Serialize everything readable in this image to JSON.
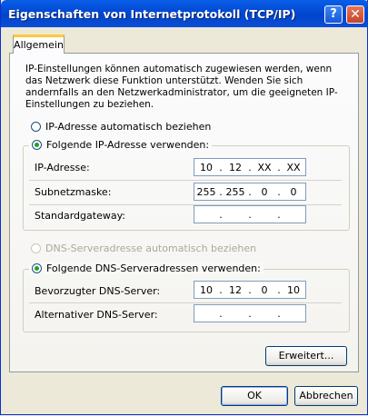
{
  "window": {
    "title": "Eigenschaften von Internetprotokoll (TCP/IP)",
    "help_glyph": "?",
    "close_glyph": "✕"
  },
  "tab": {
    "label": "Allgemein"
  },
  "description": "IP-Einstellungen können automatisch zugewiesen werden, wenn das Netzwerk diese Funktion unterstützt. Wenden Sie sich andernfalls an den Netzwerkadministrator, um die geeigneten IP-Einstellungen zu beziehen.",
  "ip": {
    "auto_label": "IP-Adresse automatisch beziehen",
    "manual_label": "Folgende IP-Adresse verwenden:",
    "address_label": "IP-Adresse:",
    "address": [
      "10",
      "12",
      "XX",
      "XX"
    ],
    "subnet_label": "Subnetzmaske:",
    "subnet": [
      "255",
      "255",
      "0",
      "0"
    ],
    "gateway_label": "Standardgateway:",
    "gateway": [
      "",
      "",
      "",
      ""
    ]
  },
  "dns": {
    "auto_label": "DNS-Serveradresse automatisch beziehen",
    "manual_label": "Folgende DNS-Serveradressen verwenden:",
    "preferred_label": "Bevorzugter DNS-Server:",
    "preferred": [
      "10",
      "12",
      "0",
      "10"
    ],
    "alternate_label": "Alternativer DNS-Server:",
    "alternate": [
      "",
      "",
      "",
      ""
    ]
  },
  "buttons": {
    "advanced": "Erweitert...",
    "ok": "OK",
    "cancel": "Abbrechen"
  }
}
